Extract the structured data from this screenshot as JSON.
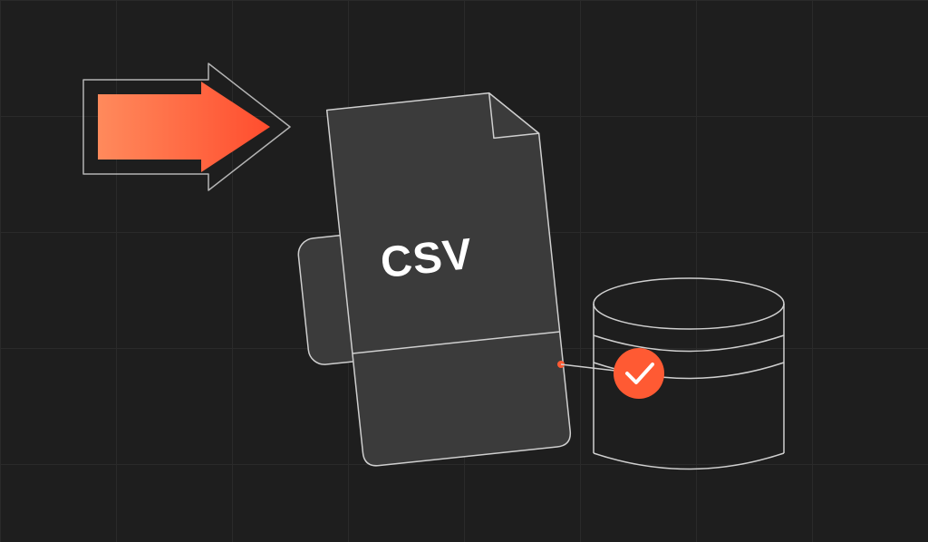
{
  "diagram": {
    "file_label": "CSV",
    "colors": {
      "background": "#1e1e1e",
      "grid": "#2a2a2a",
      "outline": "#cfcfcf",
      "file_fill": "#3b3b3b",
      "accent_start": "#ff7a45",
      "accent_end": "#ff4d2e",
      "check_bg": "#ff5a33",
      "check_fg": "#ffffff"
    },
    "elements": {
      "arrow": "right-arrow-icon",
      "file": "csv-file-icon",
      "database": "database-icon",
      "check": "check-badge-icon"
    }
  }
}
